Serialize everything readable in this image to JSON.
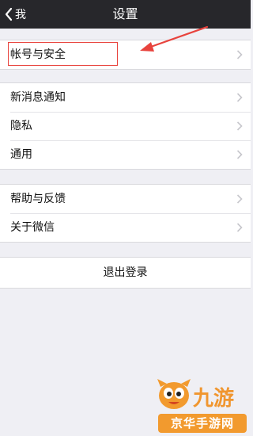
{
  "nav": {
    "back_label": "我",
    "title": "设置"
  },
  "groups": [
    {
      "items": [
        {
          "label": "帐号与安全"
        }
      ]
    },
    {
      "items": [
        {
          "label": "新消息通知"
        },
        {
          "label": "隐私"
        },
        {
          "label": "通用"
        }
      ]
    },
    {
      "items": [
        {
          "label": "帮助与反馈"
        },
        {
          "label": "关于微信"
        }
      ]
    }
  ],
  "logout_label": "退出登录",
  "annotation": {
    "color": "#e8433d"
  },
  "watermark": {
    "brand": "九游",
    "domain": "京华手游网",
    "color": "#f0962f"
  },
  "colors": {
    "nav_background": "#27272b",
    "page_background": "#efeff4",
    "chevron": "#c7c7cc"
  }
}
